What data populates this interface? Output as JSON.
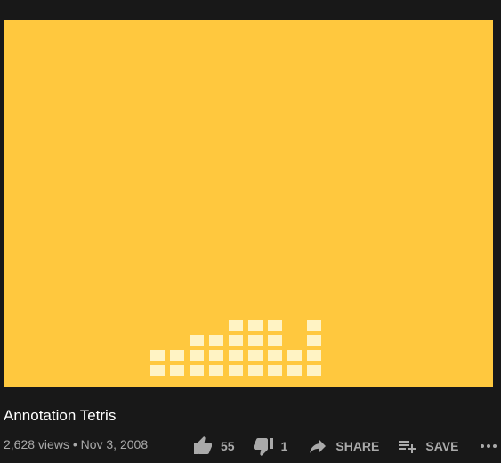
{
  "video": {
    "title": "Annotation Tetris",
    "meta": "2,628 views • Nov 3, 2008"
  },
  "actions": {
    "like_count": "55",
    "dislike_count": "1",
    "share_label": "SHARE",
    "save_label": "SAVE"
  },
  "colors": {
    "page_background": "#181818",
    "video_background": "#ffc83e",
    "tetris_blocks": "#fff3c4",
    "text_primary": "#ffffff",
    "text_secondary": "#aaaaaa"
  },
  "icons": [
    "thumbs-up-icon",
    "thumbs-down-icon",
    "share-icon",
    "playlist-add-icon",
    "more-horizontal-icon"
  ],
  "tetris_stack": {
    "column_heights": [
      2,
      2,
      3,
      3,
      4,
      4,
      4,
      2,
      4
    ]
  }
}
